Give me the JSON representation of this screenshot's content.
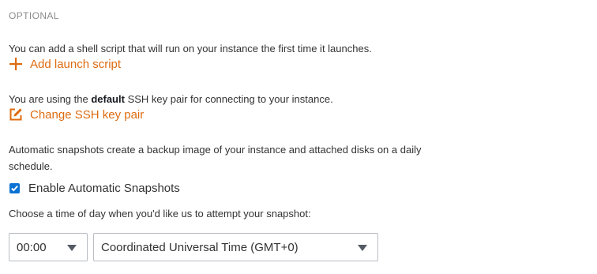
{
  "section": {
    "label": "OPTIONAL"
  },
  "launch_script": {
    "description": "You can add a shell script that will run on your instance the first time it launches.",
    "link_label": "Add launch script",
    "icon": "plus-icon"
  },
  "ssh": {
    "description_before": "You are using the ",
    "description_bold": "default",
    "description_after": " SSH key pair for connecting to your instance.",
    "link_label": "Change SSH key pair",
    "icon": "edit-icon"
  },
  "snapshots": {
    "description_line1": "Automatic snapshots create a backup image of your instance and attached disks on a daily",
    "description_line2": "schedule.",
    "checkbox_label": "Enable Automatic Snapshots",
    "checkbox_checked": true,
    "time_prompt": "Choose a time of day when you'd like us to attempt your snapshot:",
    "time_value": "00:00",
    "timezone_value": "Coordinated Universal Time (GMT+0)"
  },
  "colors": {
    "accent": "#dd6b10",
    "checkbox": "#0972d3",
    "border": "#b8bcc3",
    "text": "#333333",
    "muted": "#8c8c8c"
  }
}
